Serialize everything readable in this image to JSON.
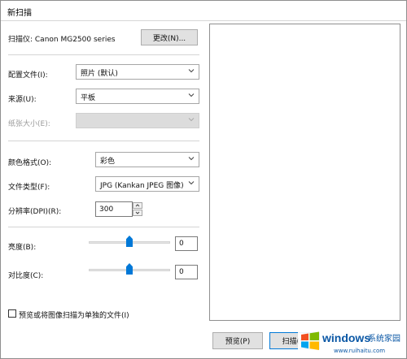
{
  "window": {
    "title": "新扫描"
  },
  "scanner": {
    "label": "扫描仪: Canon MG2500 series",
    "change_button": "更改(N)..."
  },
  "profile": {
    "label": "配置文件(I):",
    "value": "照片 (默认)"
  },
  "source": {
    "label": "来源(U):",
    "value": "平板"
  },
  "paper_size": {
    "label": "纸张大小(E):",
    "value": ""
  },
  "color_format": {
    "label": "颜色格式(O):",
    "value": "彩色"
  },
  "file_type": {
    "label": "文件类型(F):",
    "value": "JPG (Kankan JPEG 图像)"
  },
  "resolution": {
    "label": "分辨率(DPI)(R):",
    "value": "300"
  },
  "brightness": {
    "label": "亮度(B):",
    "value": "0",
    "level": 0.5
  },
  "contrast": {
    "label": "对比度(C):",
    "value": "0",
    "level": 0.5
  },
  "separate_files": {
    "label": "预览或将图像扫描为单独的文件(I)",
    "checked": false
  },
  "footer": {
    "preview_button": "预览(P)",
    "scan_button": "扫描(S)"
  },
  "watermark": {
    "brand": "windows",
    "text": "系统家园",
    "url": "www.ruihaitu.com"
  },
  "colors": {
    "accent": "#0078d7"
  }
}
